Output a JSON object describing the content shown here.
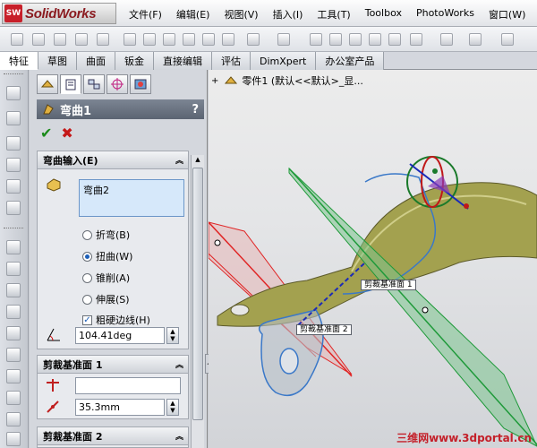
{
  "app": {
    "logo_badge": "SW",
    "logo_text": "SolidWorks"
  },
  "menu": [
    "文件(F)",
    "编辑(E)",
    "视图(V)",
    "插入(I)",
    "工具(T)",
    "Toolbox",
    "PhotoWorks",
    "窗口(W)"
  ],
  "tabs": [
    {
      "label": "特征",
      "active": true
    },
    {
      "label": "草图",
      "active": false
    },
    {
      "label": "曲面",
      "active": false
    },
    {
      "label": "钣金",
      "active": false
    },
    {
      "label": "直接编辑",
      "active": false
    },
    {
      "label": "评估",
      "active": false
    },
    {
      "label": "DimXpert",
      "active": false
    },
    {
      "label": "办公室产品",
      "active": false
    }
  ],
  "property_manager": {
    "title": "弯曲1",
    "help": "?",
    "ok_icon": "✔",
    "cancel_icon": "✖",
    "bend_input": {
      "header": "弯曲输入(E)",
      "selected_body": "弯曲2",
      "options": [
        {
          "label": "折弯(B)",
          "checked": false
        },
        {
          "label": "扭曲(W)",
          "checked": true
        },
        {
          "label": "锥削(A)",
          "checked": false
        },
        {
          "label": "伸展(S)",
          "checked": false
        }
      ],
      "hard_edges": {
        "label": "粗硬边线(H)",
        "checked": true
      },
      "angle_value": "104.41deg"
    },
    "trim_plane_1": {
      "header": "剪裁基准面 1",
      "reference_value": "",
      "offset_value": "35.3mm"
    },
    "trim_plane_2": {
      "header": "剪裁基准面 2"
    }
  },
  "graphics": {
    "tree_label": "零件1  (默认<<默认>_显...",
    "plane_label_1": "剪裁基准面 1",
    "plane_label_2": "剪裁基准面 2",
    "watermark": "三维网www.3dportal.cn"
  },
  "colors": {
    "part_body": "#9c9a4a",
    "plane_red": "#e02424",
    "plane_green": "#1f9a3a",
    "outline_blue": "#3a78c8"
  }
}
